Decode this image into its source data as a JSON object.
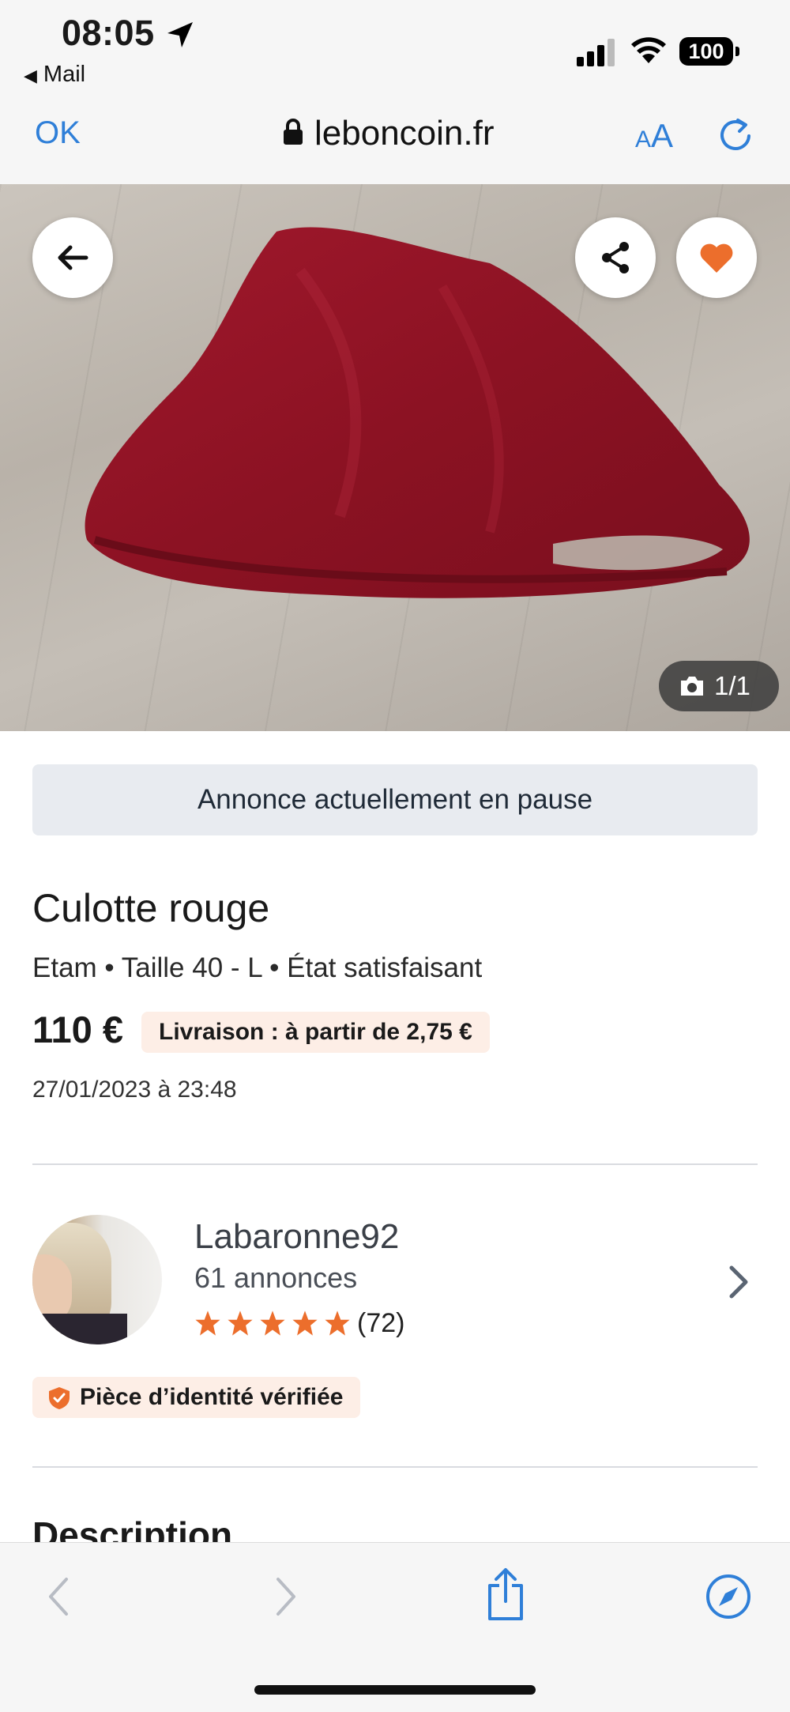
{
  "status_bar": {
    "time": "08:05",
    "back_app": "Mail",
    "battery": "100"
  },
  "browser": {
    "ok_label": "OK",
    "url": "leboncoin.fr",
    "text_size_small": "A",
    "text_size_large": "A"
  },
  "photo": {
    "counter": "1/1"
  },
  "listing": {
    "pause_notice": "Annonce actuellement en pause",
    "title": "Culotte rouge",
    "specs": "Etam • Taille 40 - L • État satisfaisant",
    "price": "110 €",
    "delivery": "Livraison : à partir de 2,75 €",
    "date": "27/01/2023 à 23:48"
  },
  "seller": {
    "name": "Labaronne92",
    "listings": "61 annonces",
    "stars": 5,
    "rating_count": "(72)",
    "verified": "Pièce d’identité vérifiée"
  },
  "description_heading": "Description",
  "colors": {
    "brand_orange": "#ec6e2c",
    "ios_blue": "#2f7fd8"
  }
}
